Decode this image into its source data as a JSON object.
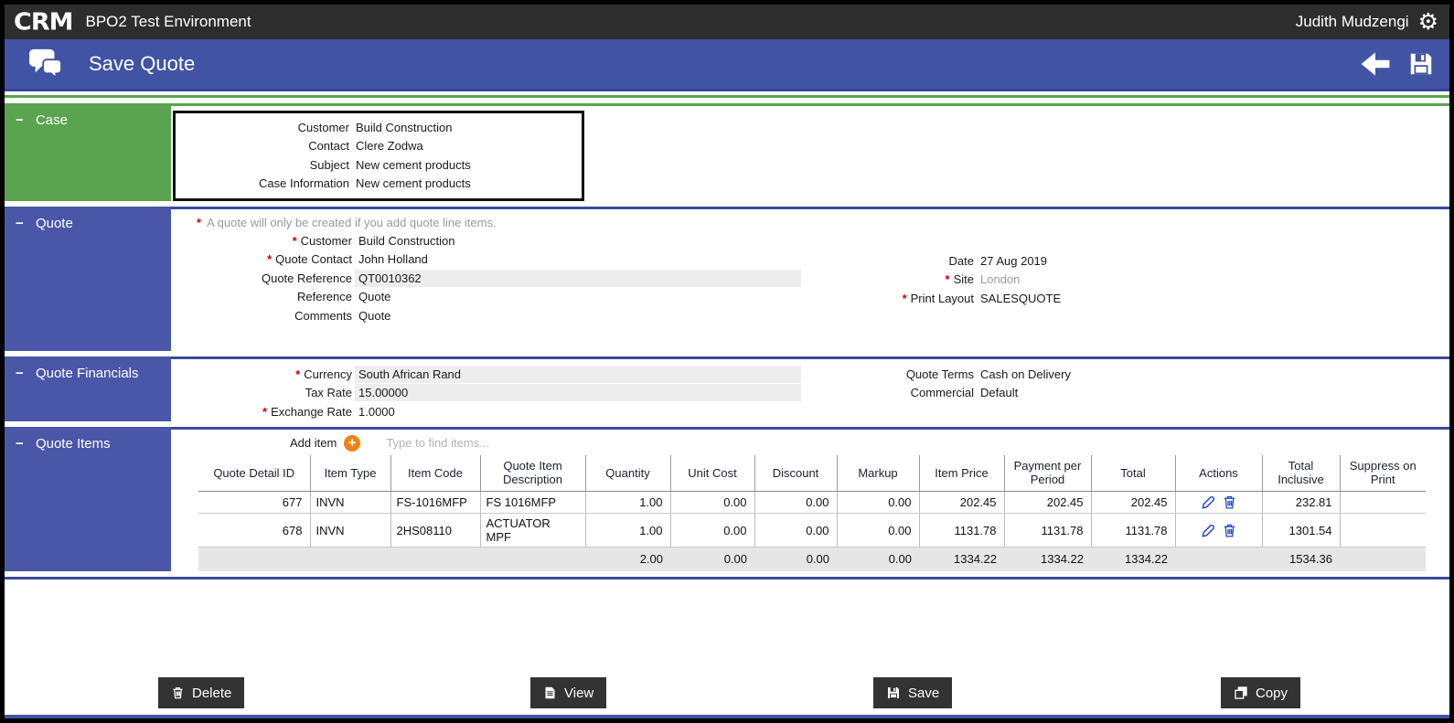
{
  "topbar": {
    "logo": "CRM",
    "app_title": "BPO2 Test Environment",
    "user_name": "Judith Mudzengi"
  },
  "titlebar": {
    "title": "Save Quote"
  },
  "required_marker": "*",
  "collapse_marker": "−",
  "case_section": {
    "label": "Case",
    "fields": [
      {
        "label": "Customer",
        "value": "Build Construction"
      },
      {
        "label": "Contact",
        "value": "Clere Zodwa"
      },
      {
        "label": "Subject",
        "value": "New cement products"
      },
      {
        "label": "Case Information",
        "value": "New cement products"
      }
    ]
  },
  "quote_section": {
    "label": "Quote",
    "note": "A quote will only be created if you add quote line items.",
    "fields_left": [
      {
        "label": "Customer",
        "value": "Build Construction"
      },
      {
        "label": "Quote Contact",
        "value": "John Holland"
      },
      {
        "label": "Quote Reference",
        "value": "QT0010362"
      },
      {
        "label": "Reference",
        "value": "Quote"
      },
      {
        "label": "Comments",
        "value": "Quote"
      }
    ],
    "fields_right": [
      {
        "label": "Date",
        "value": "27 Aug 2019"
      },
      {
        "label": "Site",
        "value": "London"
      },
      {
        "label": "Print Layout",
        "value": "SALESQUOTE"
      }
    ]
  },
  "financials_section": {
    "label": "Quote Financials",
    "fields_left": [
      {
        "label": "Currency",
        "value": "South African Rand"
      },
      {
        "label": "Tax Rate",
        "value": "15.00000"
      },
      {
        "label": "Exchange Rate",
        "value": "1.0000"
      }
    ],
    "fields_right": [
      {
        "label": "Quote Terms",
        "value": "Cash on Delivery"
      },
      {
        "label": "Commercial",
        "value": "Default"
      }
    ]
  },
  "items_section": {
    "label": "Quote Items",
    "add_item_label": "Add item",
    "search_placeholder": "Type to find items...",
    "columns": [
      "Quote Detail ID",
      "Item Type",
      "Item Code",
      "Quote Item Description",
      "Quantity",
      "Unit Cost",
      "Discount",
      "Markup",
      "Item Price",
      "Payment per Period",
      "Total",
      "Actions",
      "Total Inclusive",
      "Suppress on Print"
    ],
    "rows": [
      [
        "677",
        "INVN",
        "FS-1016MFP",
        "FS 1016MFP",
        "1.00",
        "0.00",
        "0.00",
        "0.00",
        "202.45",
        "202.45",
        "202.45",
        "",
        "232.81",
        ""
      ],
      [
        "678",
        "INVN",
        "2HS08110",
        "ACTUATOR MPF",
        "1.00",
        "0.00",
        "0.00",
        "0.00",
        "1131.78",
        "1131.78",
        "1131.78",
        "",
        "1301.54",
        ""
      ]
    ],
    "totals": [
      "",
      "",
      "",
      "",
      "2.00",
      "0.00",
      "0.00",
      "0.00",
      "1334.22",
      "1334.22",
      "1334.22",
      "",
      "1534.36",
      ""
    ]
  },
  "footer_buttons": {
    "delete": "Delete",
    "view": "View",
    "save": "Save",
    "copy": "Copy"
  },
  "colors": {
    "titlebar_blue": "#4053a4",
    "sidebar_blue": "#4a57a8",
    "case_green": "#5aa350",
    "rule_blue": "#3b4a97",
    "accent_orange": "#ef8318",
    "action_icon_blue": "#2343c3",
    "button_dark": "#333333"
  }
}
